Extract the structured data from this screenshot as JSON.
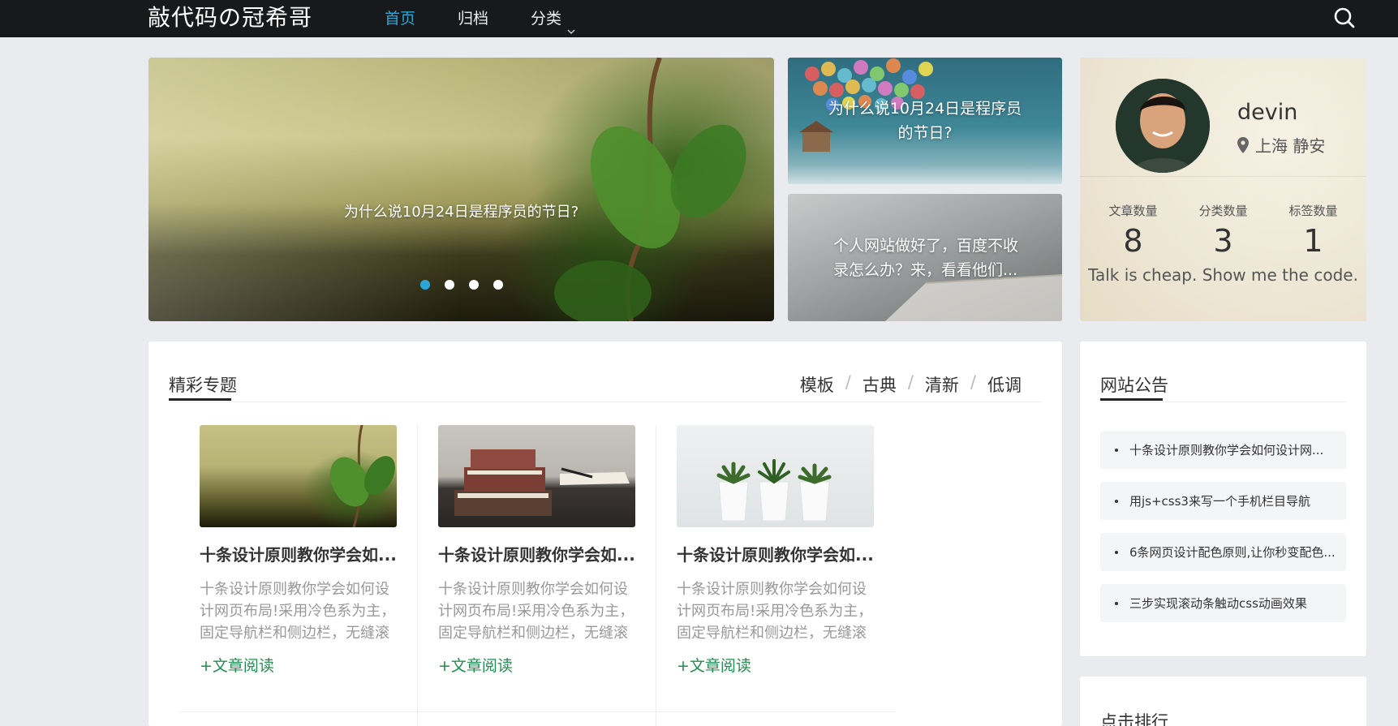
{
  "header": {
    "logo": "敲代码の冠希哥",
    "nav": [
      {
        "label": "首页",
        "active": true,
        "icon": null
      },
      {
        "label": "归档",
        "active": false,
        "icon": null
      },
      {
        "label": "分类",
        "active": false,
        "icon": "chevron-down-icon"
      }
    ],
    "search_icon": "search-icon"
  },
  "carousel": {
    "caption": "为什么说10月24日是程序员的节日?",
    "slides": 4,
    "active_slide": 1
  },
  "promos": [
    {
      "caption": "为什么说10月24日是程序员的节日?"
    },
    {
      "caption": "个人网站做好了，百度不收录怎么办？来，看看他们..."
    }
  ],
  "profile": {
    "name": "devin",
    "location": "上海 静安",
    "location_icon": "map-pin-icon",
    "stats": [
      {
        "label": "文章数量",
        "value": "8"
      },
      {
        "label": "分类数量",
        "value": "3"
      },
      {
        "label": "标签数量",
        "value": "1"
      }
    ],
    "motto": "Talk is cheap. Show me the code."
  },
  "featured": {
    "title": "精彩专题",
    "tags": [
      "模板",
      "古典",
      "清新",
      "低调"
    ],
    "cards": [
      {
        "title": "十条设计原则教你学会如...",
        "desc": "十条设计原则教你学会如何设计网页布局!采用冷色系为主，固定导航栏和侧边栏，无缝滚",
        "more": "+文章阅读",
        "image": "plant"
      },
      {
        "title": "十条设计原则教你学会如...",
        "desc": "十条设计原则教你学会如何设计网页布局!采用冷色系为主，固定导航栏和侧边栏，无缝滚",
        "more": "+文章阅读",
        "image": "books"
      },
      {
        "title": "十条设计原则教你学会如...",
        "desc": "十条设计原则教你学会如何设计网页布局!采用冷色系为主，固定导航栏和侧边栏，无缝滚",
        "more": "+文章阅读",
        "image": "pots"
      }
    ]
  },
  "notice": {
    "title": "网站公告",
    "items": [
      "十条设计原则教你学会如何设计网...",
      "用js+css3来写一个手机栏目导航",
      "6条网页设计配色原则,让你秒变配色...",
      "三步实现滚动条触动css动画效果"
    ]
  },
  "rank": {
    "title": "点击排行"
  },
  "colors": {
    "topbar": "#17191b",
    "accent": "#2aa7d8",
    "link_green": "#1f8f4f",
    "page_bg": "#e9ebee"
  }
}
